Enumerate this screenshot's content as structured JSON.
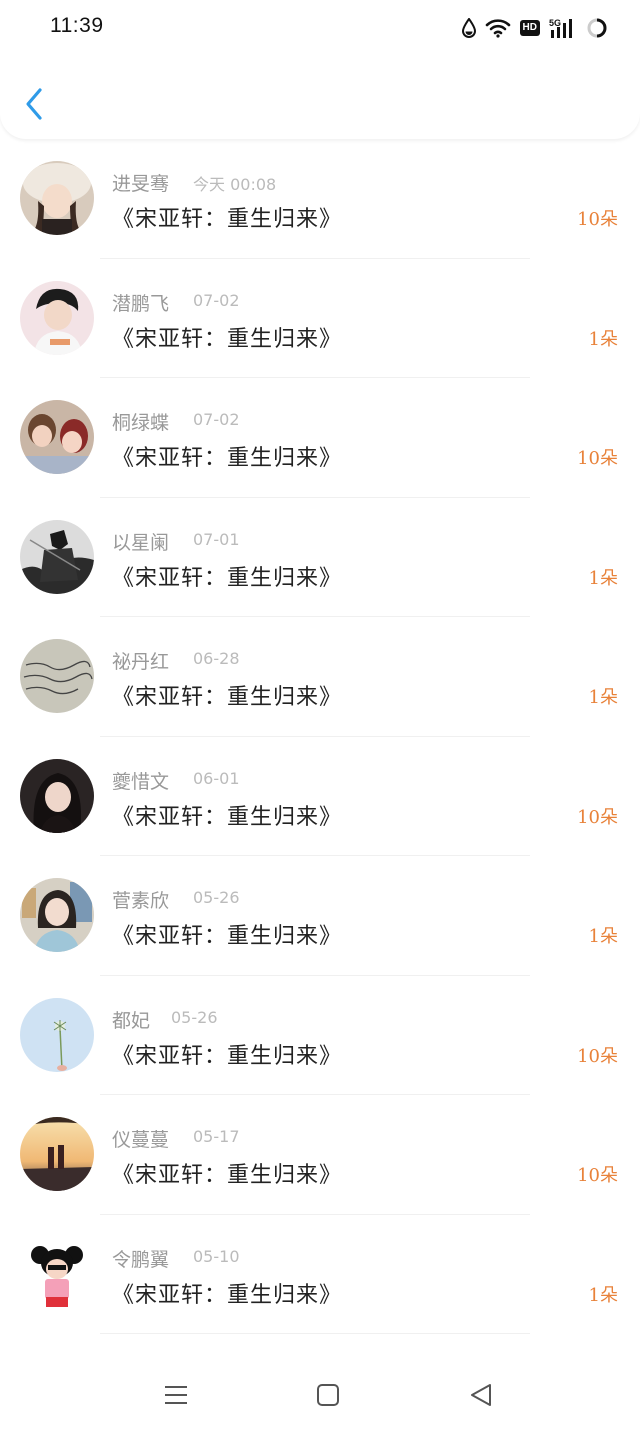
{
  "status_bar": {
    "time": "11:39",
    "icons": [
      "water-drop-icon",
      "wifi-icon",
      "hd-icon",
      "5g-signal-icon",
      "battery-ring-icon"
    ],
    "hd_label": "HD"
  },
  "header": {
    "back_icon": "chevron-left-icon",
    "accent_color": "#2f9be8"
  },
  "list": {
    "items": [
      {
        "name": "进旻骞",
        "date": "今天 00:08",
        "book": "《宋亚轩：重生归来》",
        "count": "10朵"
      },
      {
        "name": "潜鹏飞",
        "date": "07-02",
        "book": "《宋亚轩：重生归来》",
        "count": "1朵"
      },
      {
        "name": "桐绿蝶",
        "date": "07-02",
        "book": "《宋亚轩：重生归来》",
        "count": "10朵"
      },
      {
        "name": "以星阑",
        "date": "07-01",
        "book": "《宋亚轩：重生归来》",
        "count": "1朵"
      },
      {
        "name": "祕丹红",
        "date": "06-28",
        "book": "《宋亚轩：重生归来》",
        "count": "1朵"
      },
      {
        "name": "夔惜文",
        "date": "06-01",
        "book": "《宋亚轩：重生归来》",
        "count": "10朵"
      },
      {
        "name": "菅素欣",
        "date": "05-26",
        "book": "《宋亚轩：重生归来》",
        "count": "1朵"
      },
      {
        "name": "都妃",
        "date": "05-26",
        "book": "《宋亚轩：重生归来》",
        "count": "10朵"
      },
      {
        "name": "仪蔓蔓",
        "date": "05-17",
        "book": "《宋亚轩：重生归来》",
        "count": "10朵"
      },
      {
        "name": "令鹏翼",
        "date": "05-10",
        "book": "《宋亚轩：重生归来》",
        "count": "1朵"
      }
    ],
    "count_color": "#e8823a"
  },
  "nav_bar": {
    "icons": [
      "menu-icon",
      "home-square-icon",
      "back-triangle-icon"
    ]
  }
}
